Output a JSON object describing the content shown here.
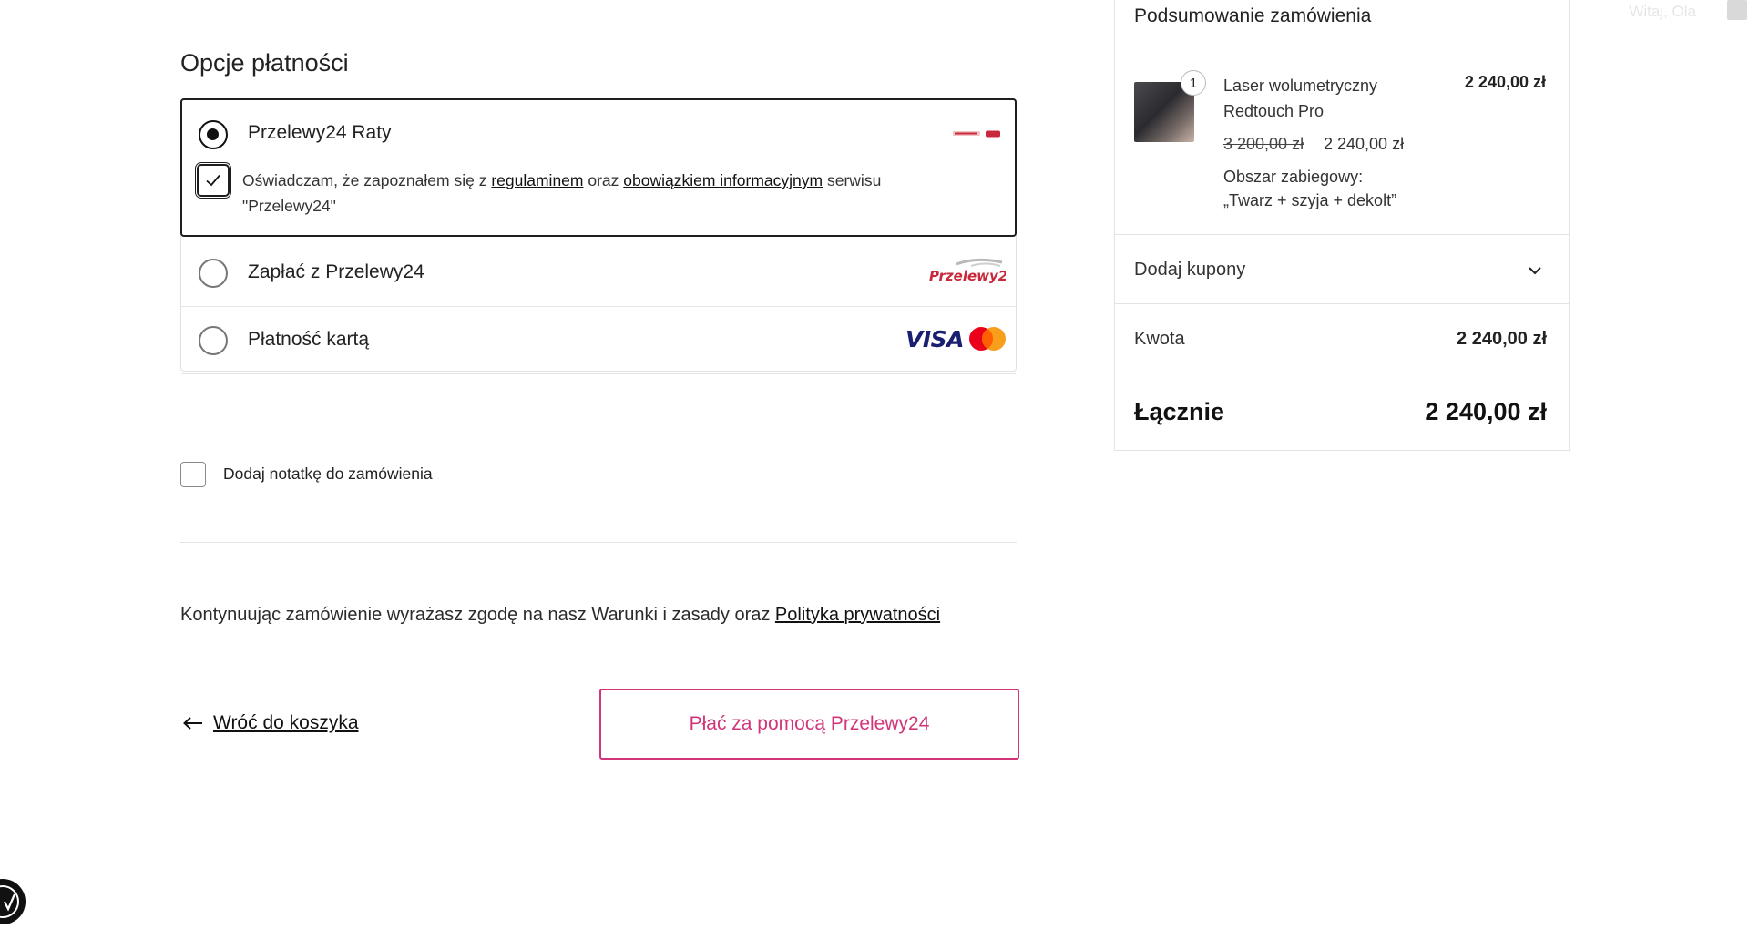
{
  "payment": {
    "title": "Opcje płatności",
    "options": [
      {
        "label": "Przelewy24 Raty",
        "selected": true,
        "logo": "przelewy24-raty-logo",
        "consent": {
          "checked": true,
          "text_before": "Oświadczam, że zapoznałem się z",
          "link1": "regulaminem",
          "text_middle": "oraz",
          "link2": "obowiązkiem informacyjnym",
          "text_after": "serwisu \"Przelewy24\""
        }
      },
      {
        "label": "Zapłać z Przelewy24",
        "selected": false,
        "logo": "Przelewy24"
      },
      {
        "label": "Płatność kartą",
        "selected": false,
        "logo_text": "VISA",
        "logo2": "mastercard-icon"
      }
    ]
  },
  "note": {
    "label": "Dodaj notatkę do zamówienia",
    "checked": false
  },
  "terms": {
    "text": "Kontynuując zamówienie wyrażasz zgodę na nasz Warunki i zasady oraz",
    "link": "Polityka prywatności"
  },
  "actions": {
    "back_label": "Wróć do koszyka",
    "pay_label": "Płać za pomocą Przelewy24"
  },
  "summary": {
    "title": "Podsumowanie zamówienia",
    "item": {
      "quantity": "1",
      "name_line1": "Laser wolumetryczny",
      "name_line2": "Redtouch Pro",
      "price": "2 240,00 zł",
      "old_price": "3 200,00 zł",
      "new_price": "2 240,00 zł",
      "area_label": "Obszar zabiegowy:",
      "area_value": "„Twarz + szyja + dekolt”"
    },
    "coupons_label": "Dodaj kupony",
    "amount_label": "Kwota",
    "amount_value": "2 240,00 zł",
    "total_label": "Łącznie",
    "total_value": "2 240,00 zł"
  },
  "header": {
    "greeting": "Witaj, Ola"
  },
  "colors": {
    "accent": "#d2357a",
    "text": "#1e1e1e",
    "border": "#e3e3e3",
    "visa": "#1a1f71"
  }
}
